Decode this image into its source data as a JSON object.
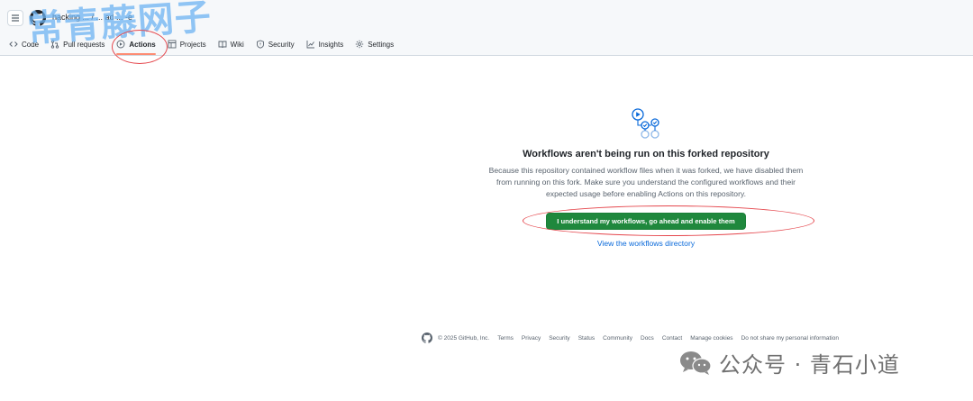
{
  "header": {
    "repo_path": "hacking ... / ... ad ... -e"
  },
  "watermark": {
    "text": "常青藤网子"
  },
  "tabs": [
    {
      "label": "Code",
      "icon": "code-icon",
      "active": false
    },
    {
      "label": "Pull requests",
      "icon": "pull-request-icon",
      "active": false
    },
    {
      "label": "Actions",
      "icon": "play-icon",
      "active": true
    },
    {
      "label": "Projects",
      "icon": "table-icon",
      "active": false
    },
    {
      "label": "Wiki",
      "icon": "book-icon",
      "active": false
    },
    {
      "label": "Security",
      "icon": "shield-icon",
      "active": false
    },
    {
      "label": "Insights",
      "icon": "graph-icon",
      "active": false
    },
    {
      "label": "Settings",
      "icon": "gear-icon",
      "active": false
    }
  ],
  "main": {
    "headline": "Workflows aren't being run on this forked repository",
    "description_lines": [
      "Because this repository contained workflow files when it was forked, we have disabled them",
      "from running on this fork. Make sure you understand the configured workflows and their",
      "expected usage before enabling Actions on this repository."
    ],
    "enable_button": "I understand my workflows, go ahead and enable them",
    "directory_link": "View the workflows directory"
  },
  "footer": {
    "copyright": "© 2025 GitHub, Inc.",
    "links": [
      "Terms",
      "Privacy",
      "Security",
      "Status",
      "Community",
      "Docs",
      "Contact",
      "Manage cookies",
      "Do not share my personal information"
    ]
  },
  "wechat": {
    "text": "公众号 · 青石小道"
  },
  "colors": {
    "primary_button": "#1f883d",
    "link": "#0969da",
    "annotation_red": "#e5474d",
    "active_tab_underline": "#fd8c73"
  }
}
